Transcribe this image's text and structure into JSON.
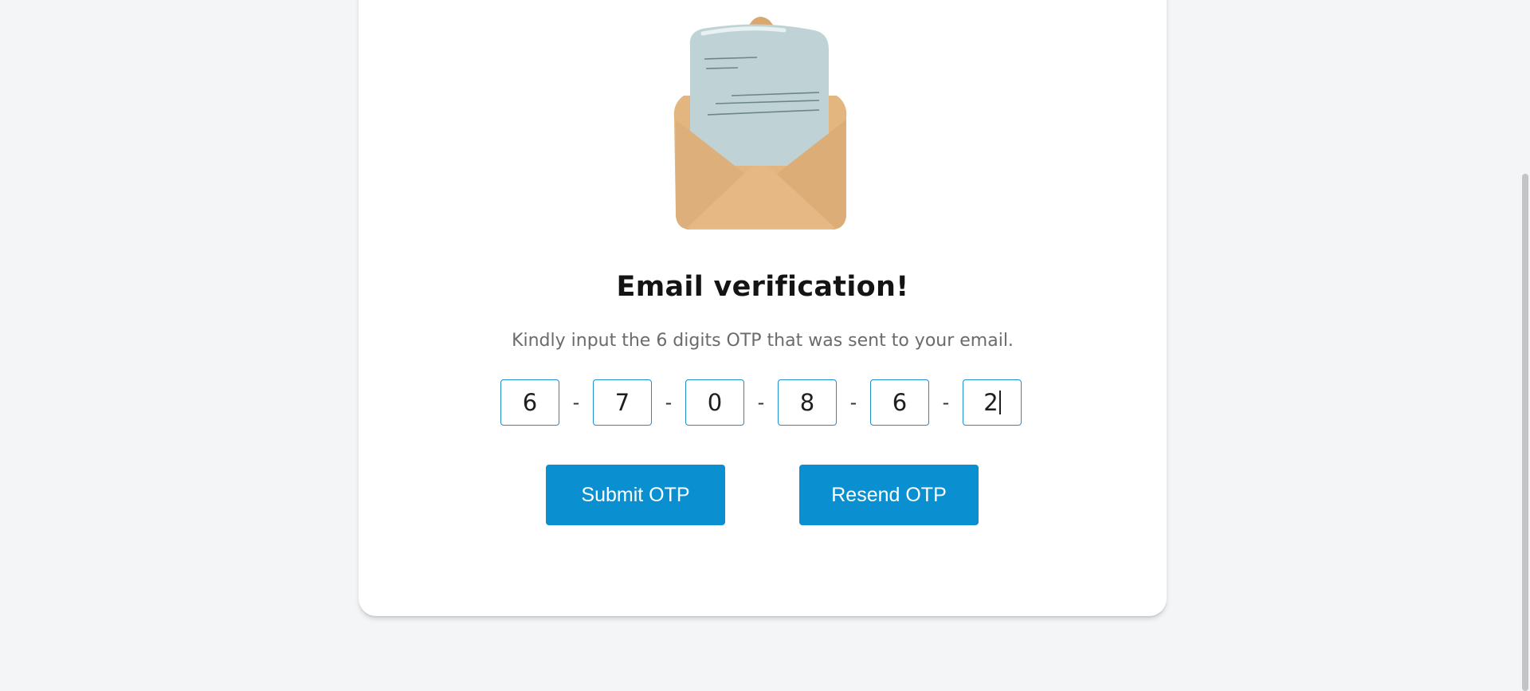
{
  "verification": {
    "title": "Email verification!",
    "subtitle": "Kindly input the 6 digits OTP that was sent to your email.",
    "otp_digits": [
      "6",
      "7",
      "0",
      "8",
      "6",
      "2"
    ],
    "separator": "-"
  },
  "actions": {
    "submit_label": "Submit OTP",
    "resend_label": "Resend OTP"
  },
  "colors": {
    "accent": "#0a90d0",
    "page_background": "#f4f5f7",
    "card_background": "#ffffff",
    "envelope": "#e3b57f",
    "letter": "#bfd3d6"
  },
  "icons": {
    "illustration": "open-envelope-with-letter"
  }
}
